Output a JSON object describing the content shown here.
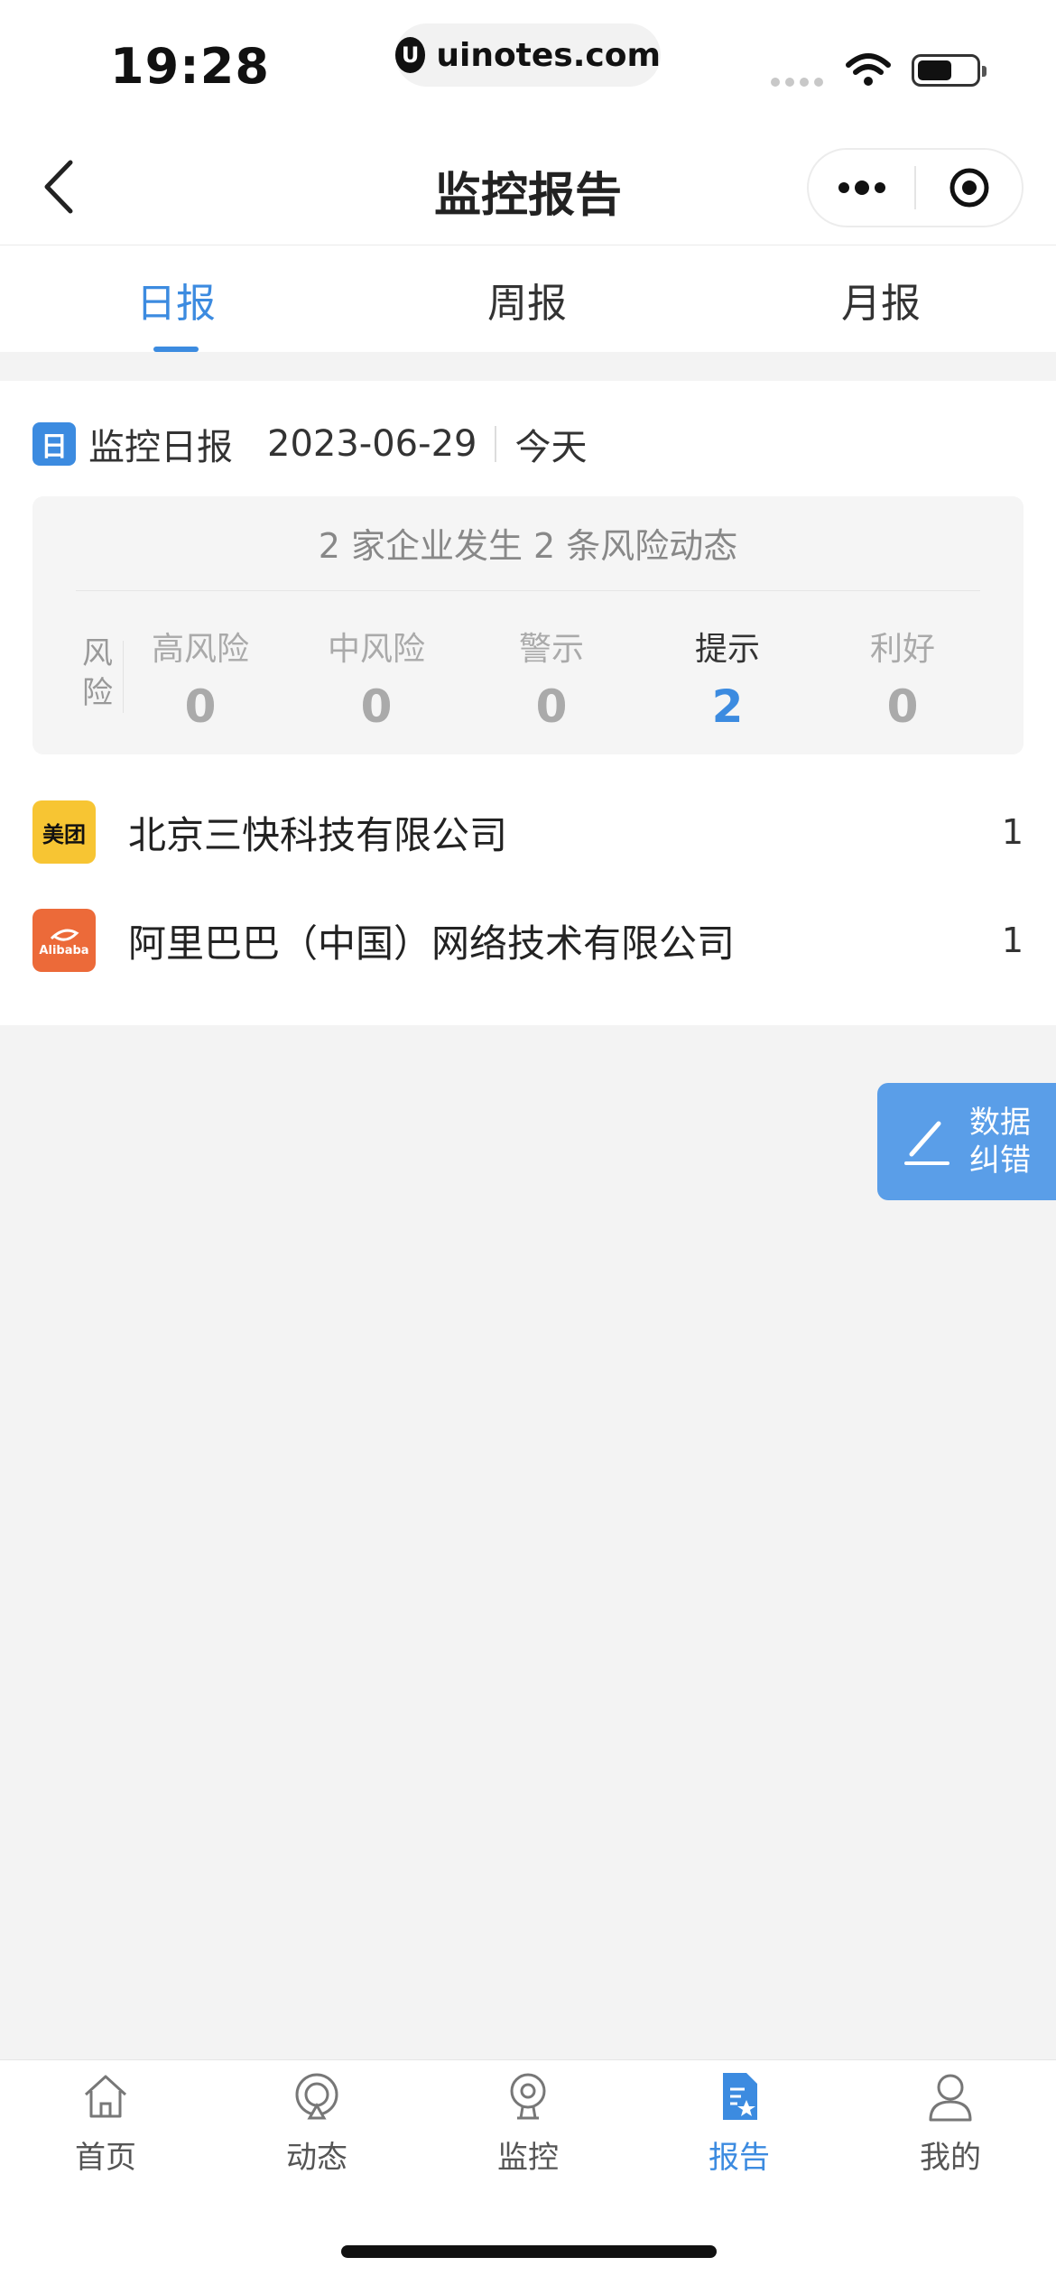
{
  "status_bar": {
    "time": "19:28",
    "url": "uinotes.com"
  },
  "nav": {
    "title": "监控报告"
  },
  "tabs": [
    {
      "label": "日报",
      "active": true
    },
    {
      "label": "周报",
      "active": false
    },
    {
      "label": "月报",
      "active": false
    }
  ],
  "report": {
    "icon_text": "日",
    "title": "监控日报",
    "date": "2023-06-29",
    "relative_day": "今天",
    "summary": "2 家企业发生 2 条风险动态",
    "risk_label": "风险",
    "risk_levels": [
      {
        "name": "高风险",
        "count": "0"
      },
      {
        "name": "中风险",
        "count": "0"
      },
      {
        "name": "警示",
        "count": "0"
      },
      {
        "name": "提示",
        "count": "2"
      },
      {
        "name": "利好",
        "count": "0"
      }
    ],
    "companies": [
      {
        "logo_text": "美团",
        "name": "北京三快科技有限公司",
        "count": "1"
      },
      {
        "logo_text": "Alibaba",
        "name": "阿里巴巴（中国）网络技术有限公司",
        "count": "1"
      }
    ]
  },
  "floating_button": {
    "label": "数据纠错"
  },
  "tabbar": [
    {
      "label": "首页",
      "icon": "home-icon",
      "active": false
    },
    {
      "label": "动态",
      "icon": "radar-icon",
      "active": false
    },
    {
      "label": "监控",
      "icon": "camera-icon",
      "active": false
    },
    {
      "label": "报告",
      "icon": "report-icon",
      "active": true
    },
    {
      "label": "我的",
      "icon": "profile-icon",
      "active": false
    }
  ],
  "colors": {
    "accent": "#3c8be0",
    "background": "#f3f3f3"
  }
}
